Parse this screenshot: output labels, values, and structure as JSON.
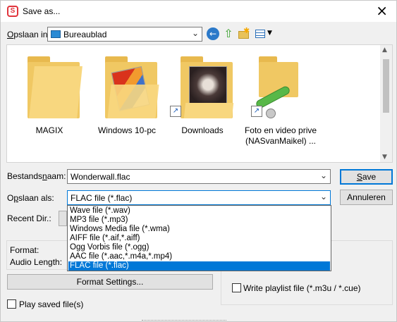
{
  "window": {
    "title": "Save as...",
    "app_icon_letter": "S"
  },
  "toolbar": {
    "lookin_label_u": "O",
    "lookin_label_rest": "pslaan in:",
    "lookin_value": "Bureaublad"
  },
  "files": [
    {
      "name": "MAGIX",
      "icon": "folder-icon"
    },
    {
      "name": "Windows 10-pc",
      "icon": "folder-with-files-icon"
    },
    {
      "name": "Downloads",
      "icon": "folder-shortcut-icon"
    },
    {
      "name": "Foto en video prive (NASvanMaikel) ...",
      "icon": "network-drive-shortcut-icon"
    }
  ],
  "filename": {
    "label_rest1": "Bestands",
    "label_u": "n",
    "label_rest2": "aam:",
    "value": "Wonderwall.flac"
  },
  "savetype": {
    "label_rest1": "O",
    "label_u": "p",
    "label_rest2": "slaan als:",
    "value": "FLAC file (*.flac)",
    "options": [
      "Wave file (*.wav)",
      "MP3 file (*.mp3)",
      "Windows Media file (*.wma)",
      "AIFF file (*.aif,*.aiff)",
      "Ogg Vorbis file (*.ogg)",
      "AAC file (*.aac,*.m4a,*.mp4)",
      "FLAC file (*.flac)"
    ],
    "selected_index": 6
  },
  "buttons": {
    "save_u": "S",
    "save_rest": "ave",
    "cancel": "Annuleren",
    "format_settings": "Format Settings..."
  },
  "recent_dir": {
    "label": "Recent Dir.:"
  },
  "info": {
    "format_label": "Format:",
    "audio_length_label": "Audio Length:"
  },
  "options": {
    "write_playlist": "Write playlist file (*.m3u / *.cue)",
    "play_saved": "Play saved file(s)"
  },
  "colors": {
    "accent": "#0078d7",
    "folder": "#f0c863",
    "dialog_bg": "#f0f0f0"
  }
}
